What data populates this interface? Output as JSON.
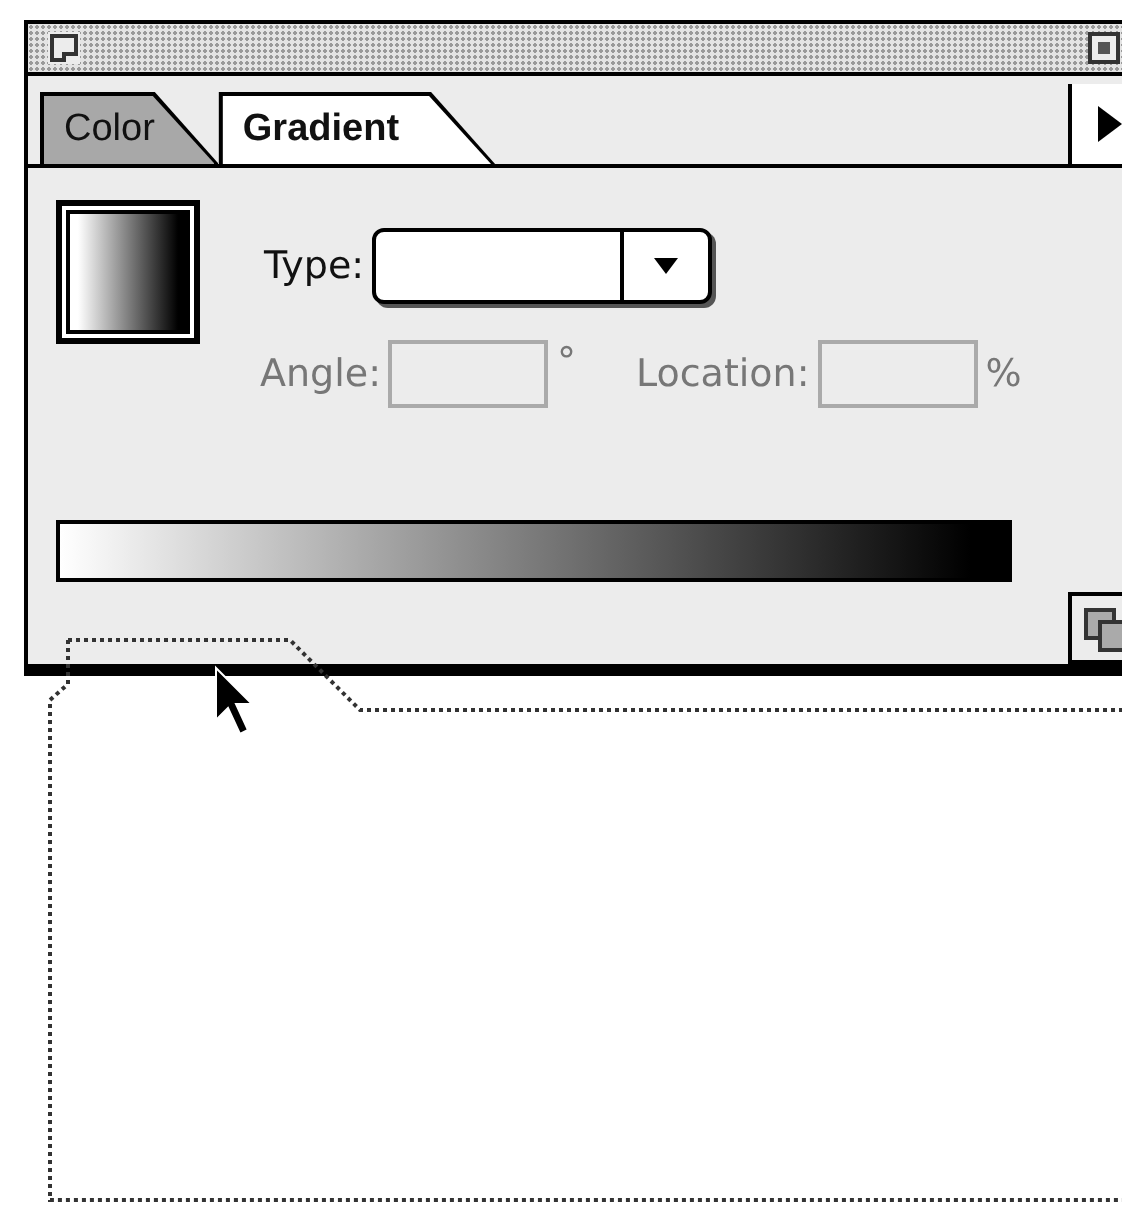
{
  "palette": {
    "tabs": [
      {
        "label": "Color",
        "selected": false
      },
      {
        "label": "Gradient",
        "selected": true
      }
    ],
    "type": {
      "label": "Type:"
    },
    "angle": {
      "label": "Angle:",
      "unit": "°"
    },
    "location": {
      "label": "Location:",
      "unit": "%"
    }
  }
}
